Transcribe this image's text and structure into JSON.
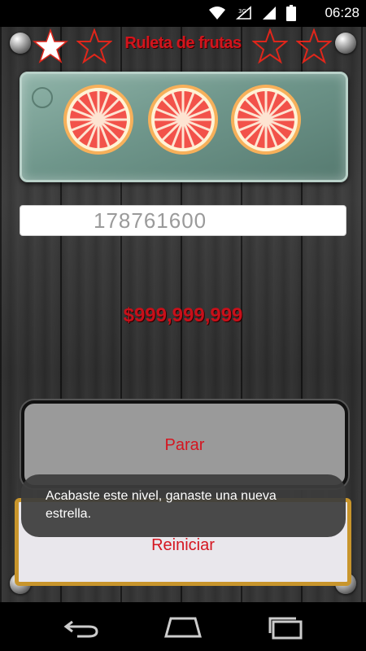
{
  "status_bar": {
    "time": "06:28",
    "icons": [
      "wifi-icon",
      "signal-3g-icon",
      "cell-signal-icon",
      "battery-icon"
    ]
  },
  "header": {
    "title": "Ruleta de frutas",
    "stars": [
      "filled",
      "empty",
      "empty",
      "empty"
    ]
  },
  "reels": {
    "symbols": [
      "grapefruit-slice-icon",
      "grapefruit-slice-icon",
      "grapefruit-slice-icon"
    ]
  },
  "counter": {
    "value": "178761600"
  },
  "money": {
    "amount": "$999,999,999"
  },
  "buttons": {
    "stop_label": "Parar",
    "restart_label": "Reiniciar"
  },
  "toast": {
    "message": "Acabaste este nivel, ganaste una nueva estrella."
  },
  "nav_bar": {
    "icons": [
      "back-icon",
      "home-icon",
      "recent-apps-icon"
    ]
  },
  "colors": {
    "title_red": "#d4141c",
    "button_text_red": "#d51620",
    "star_filled": "#ffffff",
    "star_outline": "#e0261b",
    "reiniciar_border": "#c8952c"
  }
}
